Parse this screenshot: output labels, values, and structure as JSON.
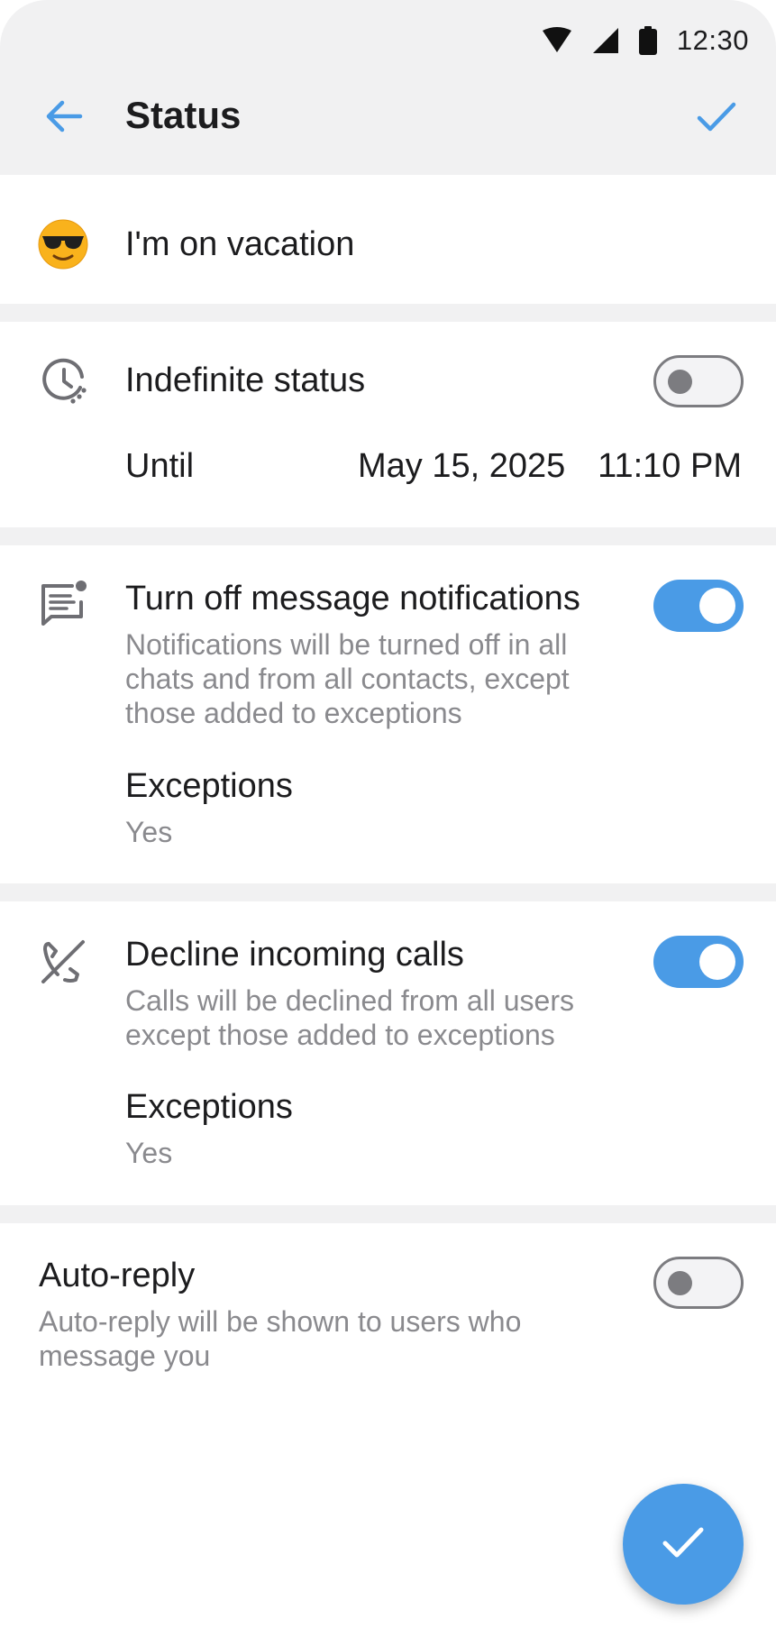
{
  "status_bar": {
    "time": "12:30",
    "icons": [
      "wifi-icon",
      "cellular-signal-icon",
      "battery-icon"
    ]
  },
  "header": {
    "title": "Status",
    "back_icon": "arrow-left-icon",
    "confirm_icon": "checkmark-icon"
  },
  "status": {
    "emoji": "smiling-face-with-sunglasses",
    "text": "I'm on vacation"
  },
  "indefinite": {
    "icon": "clock-icon",
    "label": "Indefinite status",
    "enabled": false,
    "until_label": "Until",
    "until_date": "May 15, 2025",
    "until_time": "11:10 PM"
  },
  "notifications": {
    "icon": "message-notification-icon",
    "label": "Turn off message notifications",
    "description": "Notifications will be turned off in all chats and from all contacts, except those added to exceptions",
    "enabled": true,
    "exceptions_label": "Exceptions",
    "exceptions_value": "Yes"
  },
  "calls": {
    "icon": "phone-off-icon",
    "label": "Decline incoming calls",
    "description": "Calls will be declined from all users except those added to exceptions",
    "enabled": true,
    "exceptions_label": "Exceptions",
    "exceptions_value": "Yes"
  },
  "auto_reply": {
    "label": "Auto-reply",
    "description": "Auto-reply will be shown to users who message you",
    "enabled": false
  },
  "fab": {
    "icon": "checkmark-icon"
  },
  "colors": {
    "accent": "#4a9be6",
    "header_bg": "#f1f1f2",
    "secondary_text": "#8a8a8e"
  }
}
